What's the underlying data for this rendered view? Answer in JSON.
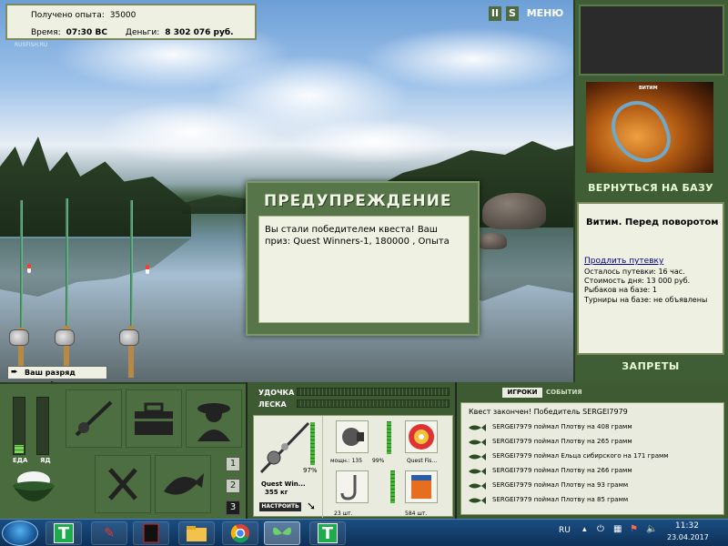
{
  "hud": {
    "experience_label": "Получено опыта:",
    "experience_value": "35000",
    "time_label": "Время:",
    "time_value": "07:30 ВС",
    "money_label": "Деньги:",
    "money_value": "8 302 076 руб.",
    "watermark": "RUSFISH.RU"
  },
  "topbar": {
    "pause_label": "II",
    "s_label": "S",
    "menu_label": "МЕНЮ"
  },
  "location": {
    "image_caption": "ВИТИМ",
    "return_label": "ВЕРНУТЬСЯ НА БАЗУ",
    "title": "Витим. Перед поворотом",
    "extend_link": "Продлить путевку",
    "remaining": "Осталось путевки: 16 час.",
    "day_cost": "Стоимость дня: 13 000 руб.",
    "anglers": "Рыбаков на базе: 1",
    "tournaments": "Турниры на базе: не объявлены",
    "bans_label": "ЗАПРЕТЫ"
  },
  "toast": {
    "text": "Ваш разряд вырос!"
  },
  "dialog": {
    "title": "ПРЕДУПРЕЖДЕНИЕ",
    "body": "Вы стали победителем квеста! Ваш приз: Quest Winners-1, 180000 , Опыта"
  },
  "status": {
    "food_label": "ЕДА",
    "poison_label": "ЯД",
    "food_level": 0.18,
    "poison_level": 0.0
  },
  "slots": {
    "page_buttons": [
      "1",
      "2",
      "3"
    ],
    "active_page": 0
  },
  "tackle": {
    "rod_label": "УДОЧКА",
    "line_label": "ЛЕСКА",
    "rod_name": "Quest Win...",
    "rod_weight": "355 кг",
    "rod_condition": "97%",
    "reel_power": "мощн.: 135",
    "reel_condition": "99%",
    "line_name": "Quest Fis...",
    "hook_count": "23 шт.",
    "bait_count": "584 шт.",
    "setup_label": "НАСТРОИТЬ"
  },
  "feed": {
    "tab_players": "ИГРОКИ",
    "tab_events": "СОБЫТИЯ",
    "header": "Квест закончен! Победитель SERGEI7979",
    "rows": [
      "SERGEI7979 поймал Плотву на 408 грамм",
      "SERGEI7979 поймал Плотву на 265 грамм",
      "SERGEI7979 поймал Ельца сибирского на 171 грамм",
      "SERGEI7979 поймал Плотву на 266 грамм",
      "SERGEI7979 поймал Плотву на 93 грамм",
      "SERGEI7979 поймал Плотву на 85 грамм"
    ]
  },
  "taskbar": {
    "lang": "RU",
    "time": "11:32",
    "date": "23.04.2017"
  },
  "colors": {
    "panel_green": "#3f5e35",
    "dialog_green": "#567548",
    "paper": "#eef0e1"
  }
}
